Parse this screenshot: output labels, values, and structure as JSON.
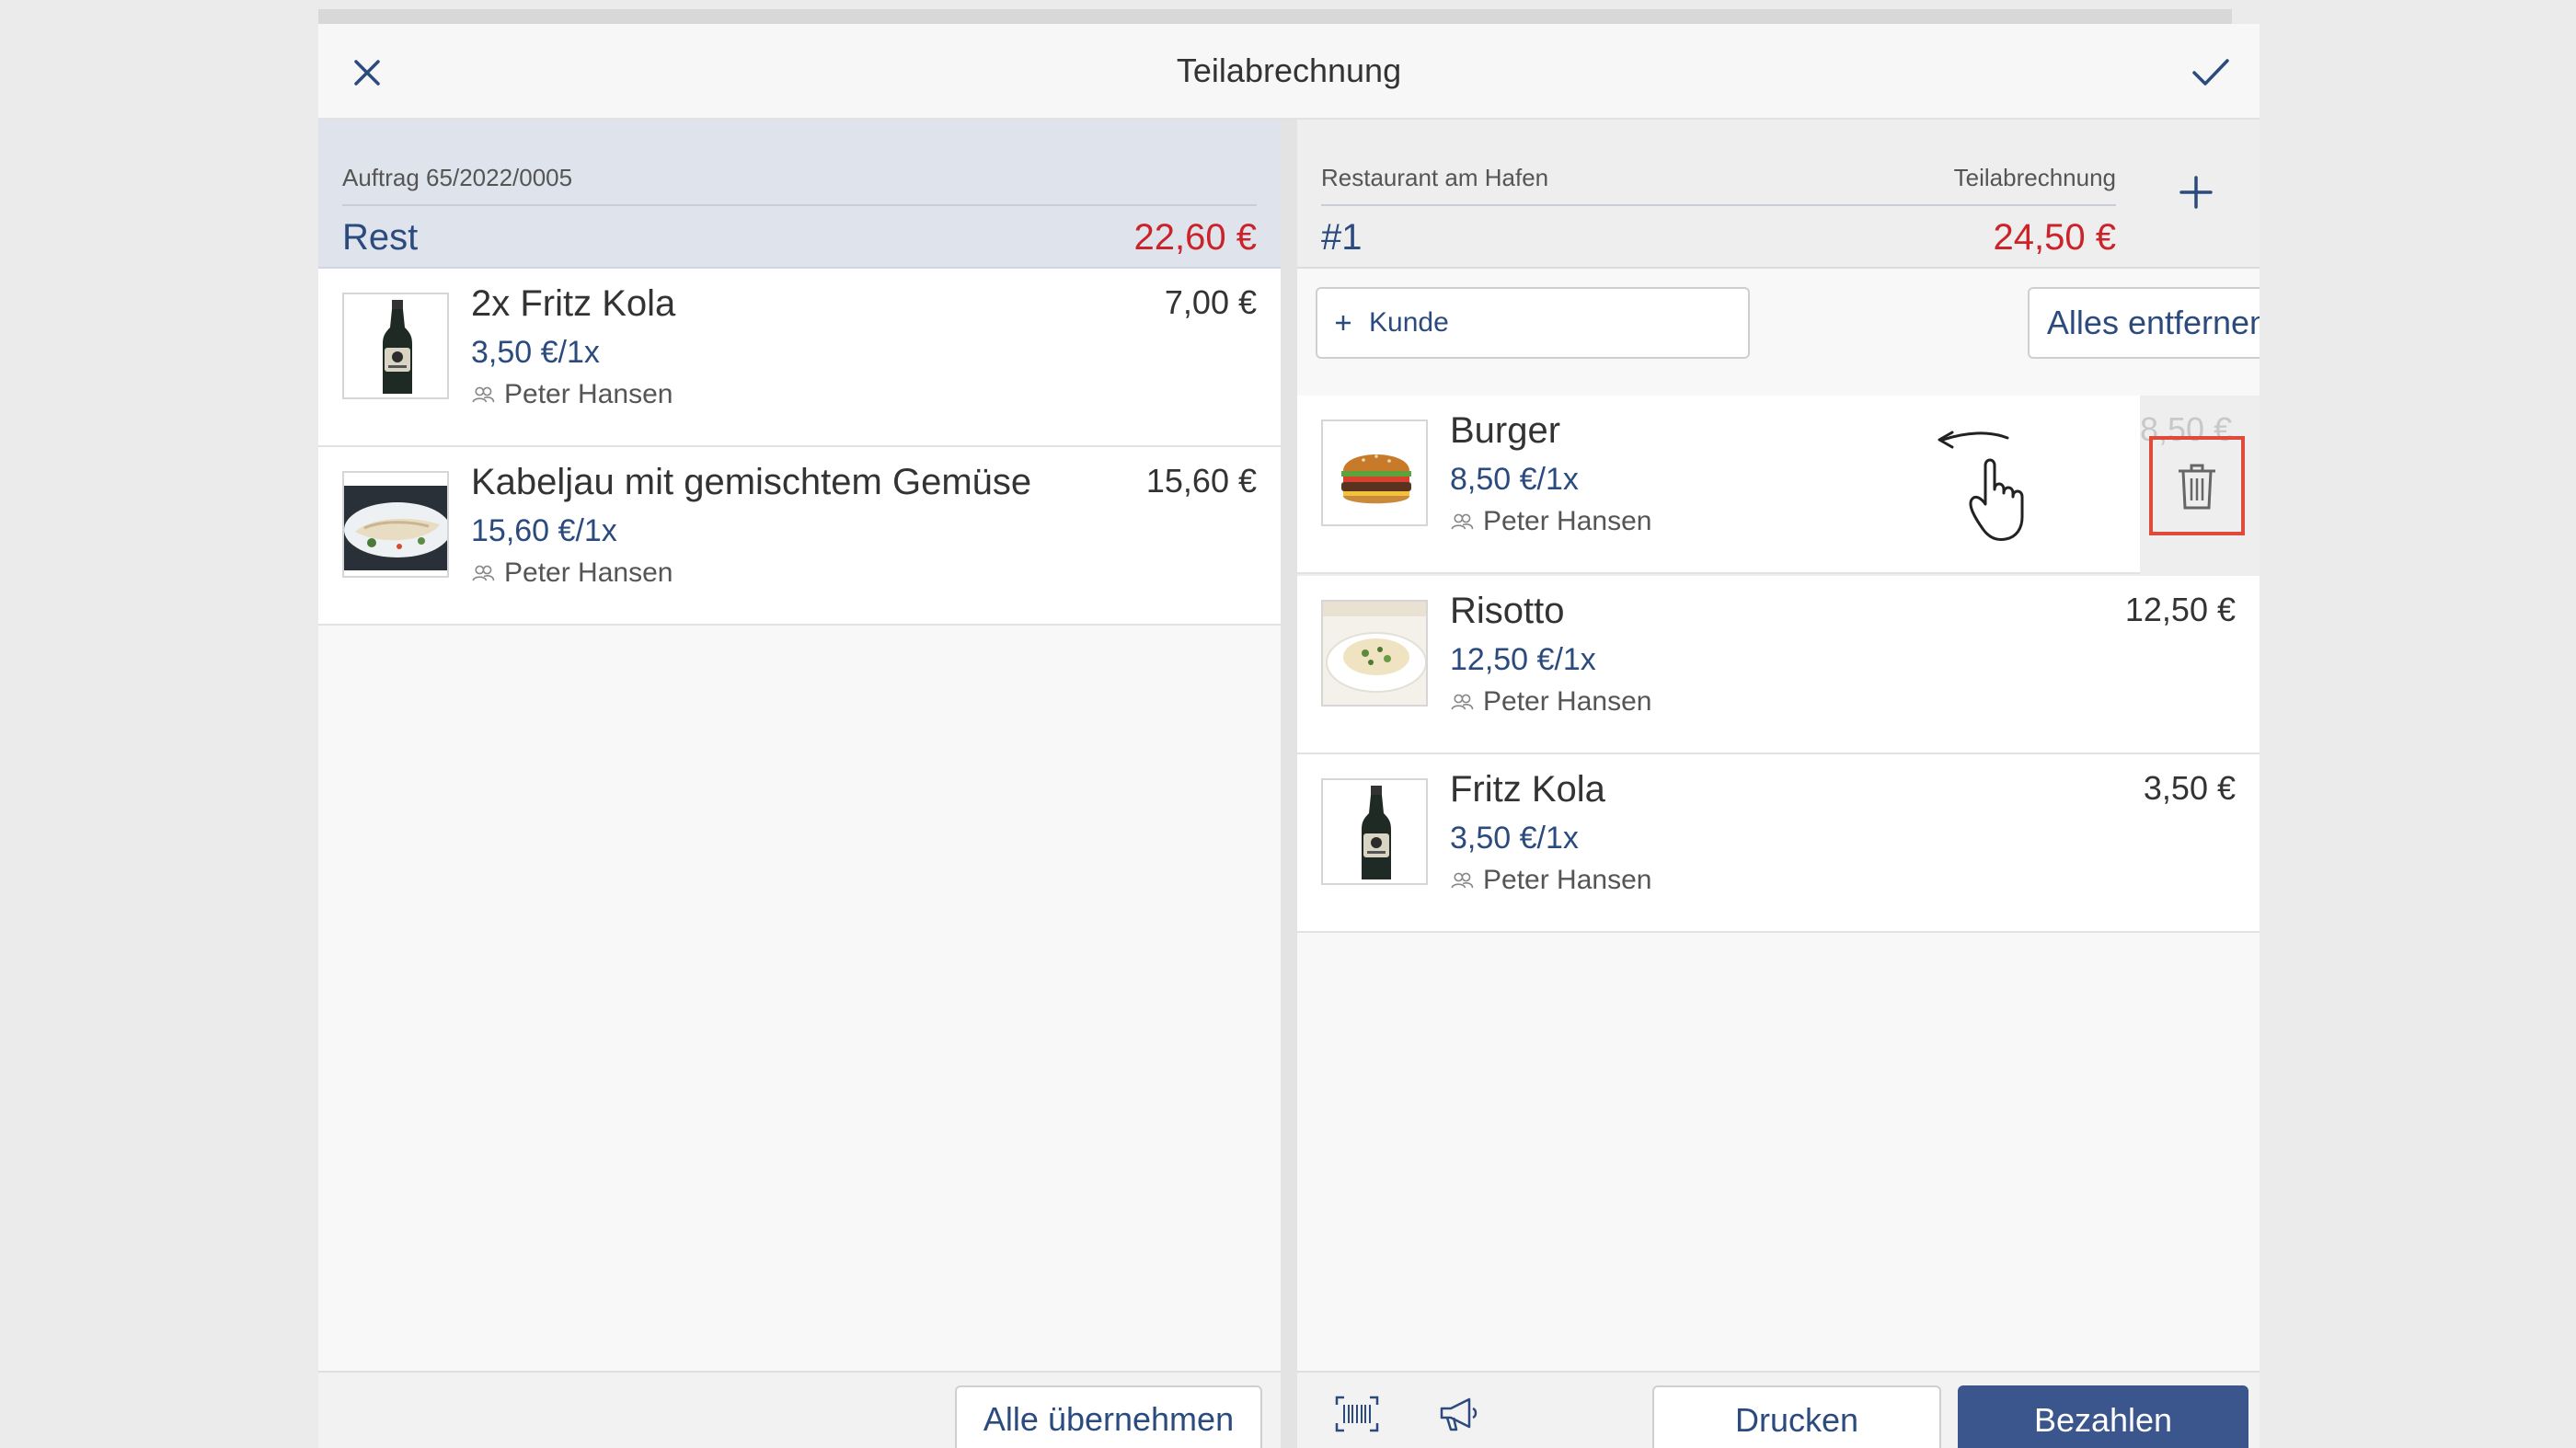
{
  "header": {
    "title": "Teilabrechnung",
    "close_icon": "close-icon",
    "confirm_icon": "check-icon"
  },
  "left": {
    "order_label": "Auftrag 65/2022/0005",
    "rest_label": "Rest",
    "rest_amount": "22,60 €",
    "items": [
      {
        "name": "2x Fritz Kola",
        "unit_price": "3,50 €/1x",
        "person": "Peter Hansen",
        "total": "7,00 €",
        "image": "cola-bottle"
      },
      {
        "name": "Kabeljau mit gemischtem Gemüse",
        "unit_price": "15,60 €/1x",
        "person": "Peter Hansen",
        "total": "15,60 €",
        "image": "fish-plate"
      }
    ],
    "take_all_label": "Alle übernehmen"
  },
  "right": {
    "restaurant_label": "Restaurant am Hafen",
    "section_label": "Teilabrechnung",
    "bill_number": "#1",
    "bill_amount": "24,50 €",
    "add_customer_label": "Kunde",
    "remove_all_label": "Alles entfernen",
    "items": [
      {
        "name": "Burger",
        "unit_price": "8,50 €/1x",
        "person": "Peter Hansen",
        "total": "8,50 €",
        "image": "burger"
      },
      {
        "name": "Risotto",
        "unit_price": "12,50 €/1x",
        "person": "Peter Hansen",
        "total": "12,50 €",
        "image": "risotto"
      },
      {
        "name": "Fritz Kola",
        "unit_price": "3,50 €/1x",
        "person": "Peter Hansen",
        "total": "3,50 €",
        "image": "cola-bottle"
      }
    ],
    "print_label": "Drucken",
    "pay_label": "Bezahlen"
  },
  "colors": {
    "accent": "#2b4b7e",
    "primary_button": "#3a568c",
    "amount_red": "#cc2229",
    "highlight": "#e04a3a"
  }
}
